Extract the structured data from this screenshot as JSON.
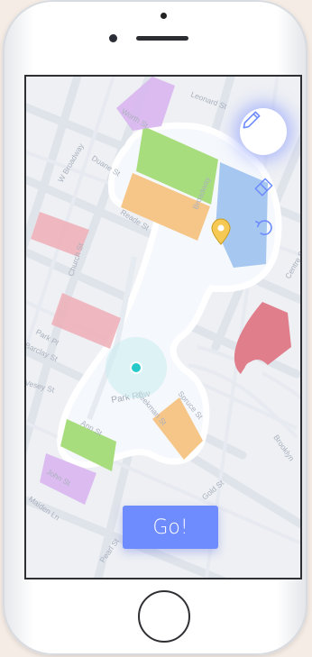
{
  "map": {
    "streets": {
      "worth": "Worth St",
      "leonard": "Leonard St",
      "w_broadway": "W Broadway",
      "duane": "Duane St",
      "broadway": "Broadway",
      "reade": "Reade St",
      "church": "Church St",
      "park_pl": "Park Pl",
      "barclay": "Barclay St",
      "vesey": "Vesey St",
      "park_row": "Park Row",
      "beekman": "Beekman St",
      "spruce": "Spruce St",
      "ann": "Ann St",
      "john": "John St",
      "maiden": "Maiden Ln",
      "pearl": "Pearl St",
      "gold": "Gold St",
      "brooklyn": "Brooklyn",
      "centre": "Centre St"
    },
    "colors": {
      "green": "#a7dd7c",
      "orange": "#f6c588",
      "blue": "#9cc1ee",
      "pink": "#eeaeb6",
      "red": "#e07e8c",
      "purple": "#d9b6ef",
      "accent": "#6f8cff",
      "location": "#27c9c9",
      "pin": "#f6c954"
    },
    "icons": {
      "draw": "pencil-icon",
      "erase": "eraser-icon",
      "undo": "undo-icon",
      "marker": "map-pin-icon",
      "current_location": "location-dot-icon"
    }
  },
  "actions": {
    "go_label": "Go!"
  }
}
